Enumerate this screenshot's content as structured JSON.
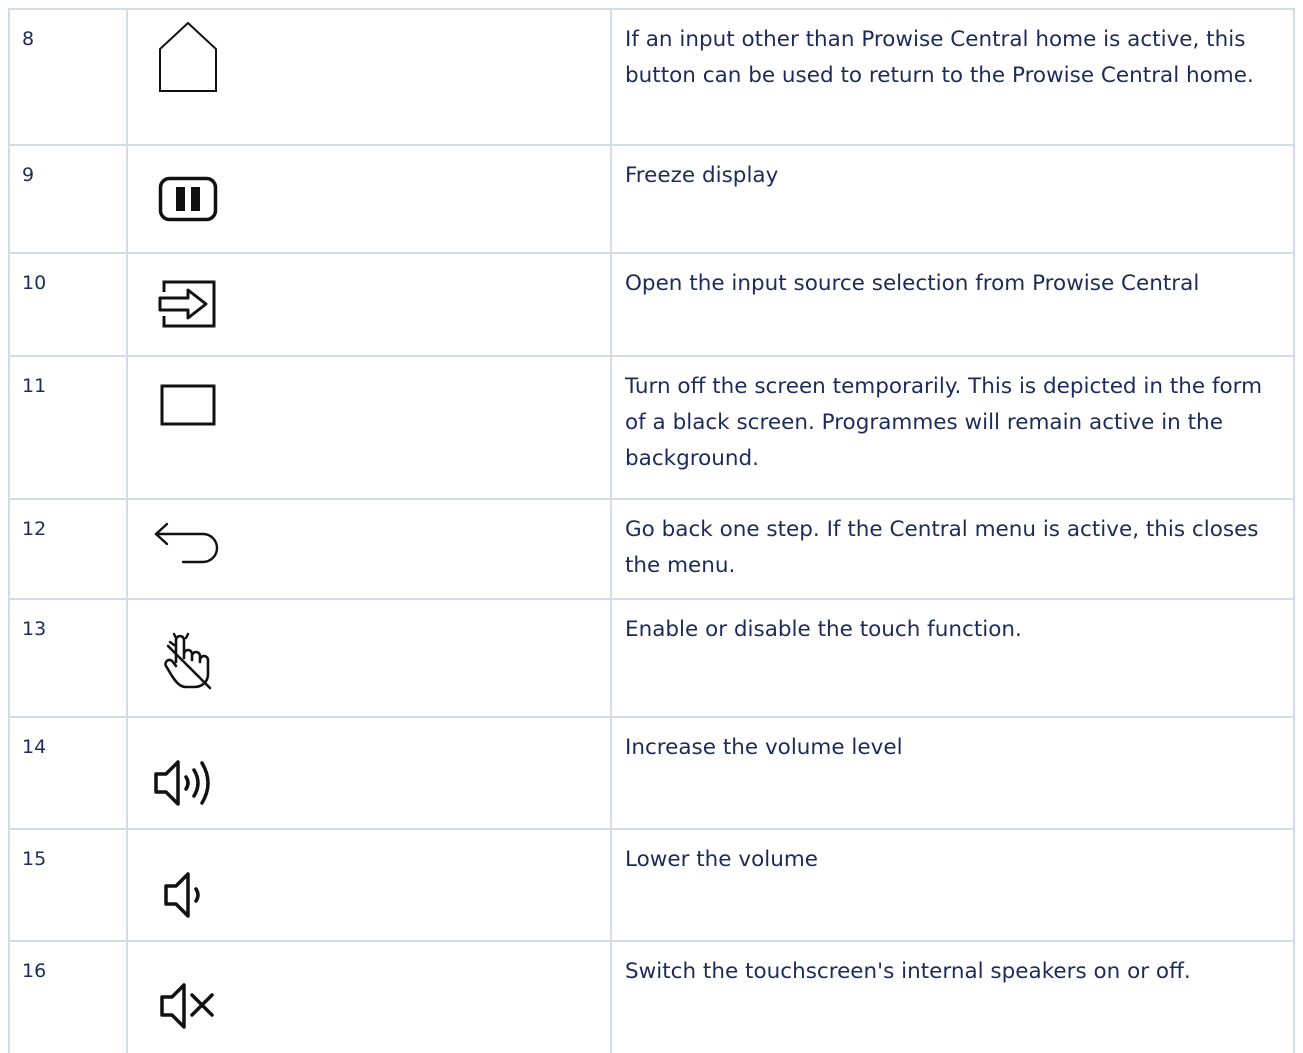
{
  "rows": [
    {
      "number": "8",
      "icon": "home-icon",
      "description": "If an input other than Prowise Central home is active, this button can be used to return to the Prowise Central home."
    },
    {
      "number": "9",
      "icon": "pause-icon",
      "description": "Freeze display"
    },
    {
      "number": "10",
      "icon": "input-source-icon",
      "description": "Open the input source selection from Prowise Central"
    },
    {
      "number": "11",
      "icon": "blank-screen-icon",
      "description": "Turn off the screen temporarily. This is depicted in the form of a black screen. Programmes will remain active in the background."
    },
    {
      "number": "12",
      "icon": "back-arrow-icon",
      "description": "Go back one step. If the Central menu is active, this closes the menu."
    },
    {
      "number": "13",
      "icon": "touch-disabled-icon",
      "description": "Enable or disable the touch function."
    },
    {
      "number": "14",
      "icon": "volume-up-icon",
      "description": "Increase the volume level"
    },
    {
      "number": "15",
      "icon": "volume-down-icon",
      "description": "Lower the volume"
    },
    {
      "number": "16",
      "icon": "mute-icon",
      "description": "Switch the touchscreen's internal speakers on or off."
    }
  ],
  "colors": {
    "text": "#1c2b5a",
    "grid": "#d3dbe8",
    "icon": "#111111"
  }
}
